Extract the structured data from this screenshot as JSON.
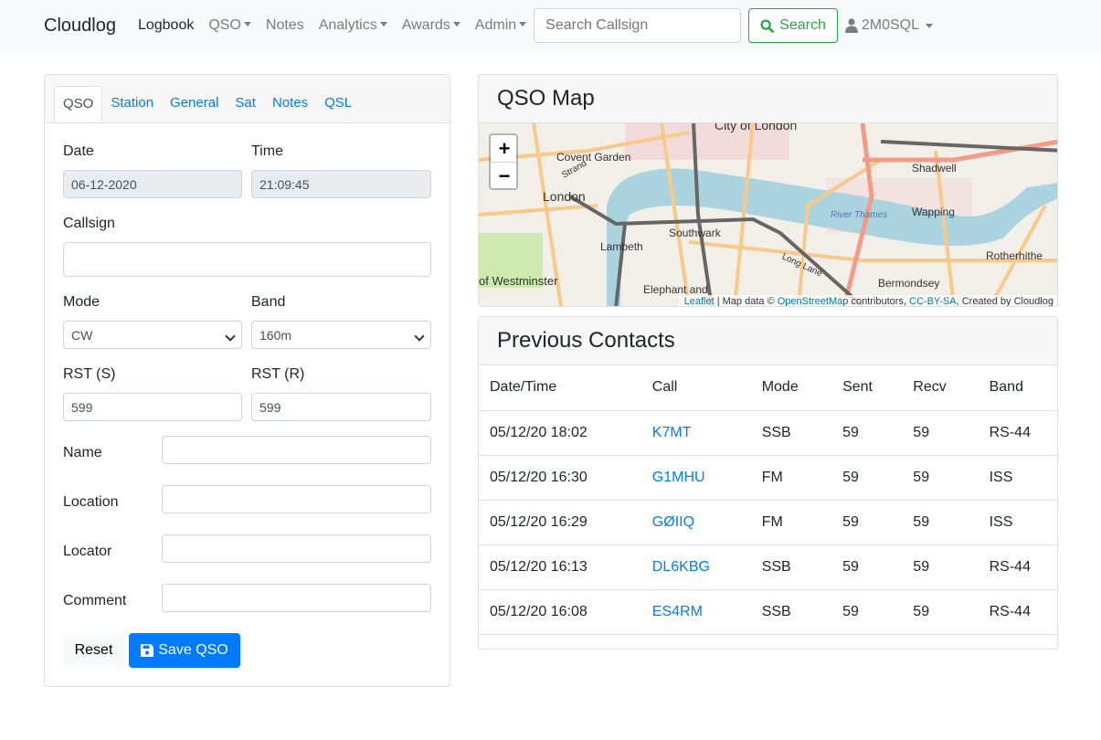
{
  "nav": {
    "brand": "Cloudlog",
    "items": [
      {
        "label": "Logbook",
        "active": true,
        "dropdown": false
      },
      {
        "label": "QSO",
        "dropdown": true
      },
      {
        "label": "Notes",
        "dropdown": false
      },
      {
        "label": "Analytics",
        "dropdown": true
      },
      {
        "label": "Awards",
        "dropdown": true
      },
      {
        "label": "Admin",
        "dropdown": true
      }
    ],
    "search_placeholder": "Search Callsign",
    "search_button": "Search",
    "user": "2M0SQL"
  },
  "form": {
    "tabs": [
      "QSO",
      "Station",
      "General",
      "Sat",
      "Notes",
      "QSL"
    ],
    "date_label": "Date",
    "date_value": "06-12-2020",
    "time_label": "Time",
    "time_value": "21:09:45",
    "callsign_label": "Callsign",
    "callsign_value": "",
    "mode_label": "Mode",
    "mode_value": "CW",
    "band_label": "Band",
    "band_value": "160m",
    "rst_s_label": "RST (S)",
    "rst_s_value": "599",
    "rst_r_label": "RST (R)",
    "rst_r_value": "599",
    "name_label": "Name",
    "location_label": "Location",
    "locator_label": "Locator",
    "comment_label": "Comment",
    "reset": "Reset",
    "save": "Save QSO"
  },
  "map": {
    "title": "QSO Map",
    "zoom_in": "+",
    "zoom_out": "−",
    "labels": [
      "City of London",
      "Covent Garden",
      "London",
      "Shadwell",
      "Wapping",
      "Southwark",
      "Lambeth",
      "River Thames",
      "Rotherhithe",
      "of Westminster",
      "Bermondsey",
      "Elephant and",
      "Long Lane",
      "Strand"
    ],
    "attribution": {
      "leaflet": "Leaflet",
      "sep": " | Map data © ",
      "osm": "OpenStreetMap",
      "contrib": " contributors, ",
      "license": "CC-BY-SA",
      "created": ", Created by Cloudlog"
    },
    "colors": {
      "land": "#f2efe9",
      "water": "#aad3df",
      "road": "#f7c98a",
      "major": "#f29b86"
    }
  },
  "contacts": {
    "title": "Previous Contacts",
    "columns": [
      "Date/Time",
      "Call",
      "Mode",
      "Sent",
      "Recv",
      "Band"
    ],
    "rows": [
      [
        "05/12/20 18:02",
        "K7MT",
        "SSB",
        "59",
        "59",
        "RS-44"
      ],
      [
        "05/12/20 16:30",
        "G1MHU",
        "FM",
        "59",
        "59",
        "ISS"
      ],
      [
        "05/12/20 16:29",
        "GØIIQ",
        "FM",
        "59",
        "59",
        "ISS"
      ],
      [
        "05/12/20 16:13",
        "DL6KBG",
        "SSB",
        "59",
        "59",
        "RS-44"
      ],
      [
        "05/12/20 16:08",
        "ES4RM",
        "SSB",
        "59",
        "59",
        "RS-44"
      ]
    ]
  }
}
